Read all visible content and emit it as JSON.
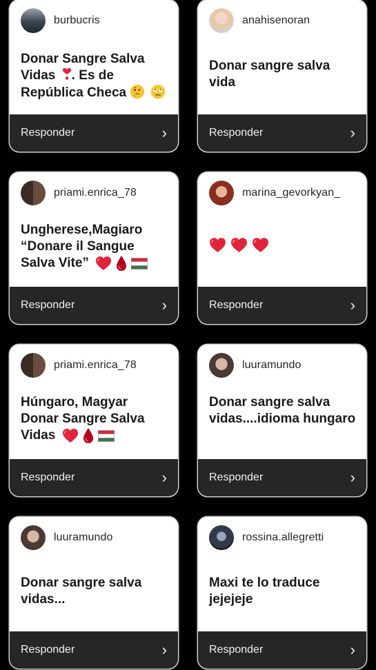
{
  "cards": [
    {
      "username": "burbucris",
      "message": "Donar Sangre Salva Vidas",
      "message_suffix": ". Es de República Checa",
      "emojis": [
        "heart-exclamation",
        "thinking-face",
        "eye-roll-face"
      ],
      "reply_label": "Responder"
    },
    {
      "username": "anahisenoran",
      "message": "Donar sangre salva vida",
      "reply_label": "Responder"
    },
    {
      "username": "priami.enrica_78",
      "message": "Ungherese,Magiaro “Donare il Sangue Salva Vite”",
      "emojis": [
        "red-heart",
        "blood-drop",
        "hungary-flag"
      ],
      "reply_label": "Responder"
    },
    {
      "username": "marina_gevorkyan_",
      "message": "",
      "emojis": [
        "red-heart",
        "red-heart",
        "red-heart"
      ],
      "reply_label": "Responder"
    },
    {
      "username": "priami.enrica_78",
      "message": "Húngaro, Magyar Donar Sangre Salva Vidas",
      "emojis": [
        "red-heart",
        "blood-drop",
        "hungary-flag"
      ],
      "reply_label": "Responder"
    },
    {
      "username": "luuramundo",
      "message": "Donar sangre salva vidas....idioma hungaro",
      "reply_label": "Responder"
    },
    {
      "username": "luuramundo",
      "message": "Donar sangre salva vidas...",
      "reply_label": "Responder"
    },
    {
      "username": "rossina.allegretti",
      "message": "Maxi te lo traduce jejejeje",
      "reply_label": "Responder"
    }
  ],
  "icons": {
    "chevron": "chevron-right-icon"
  },
  "colors": {
    "page_bg": "#000000",
    "card_bg": "#ffffff",
    "reply_bar_bg": "#262626",
    "heart": "#e0243a"
  }
}
